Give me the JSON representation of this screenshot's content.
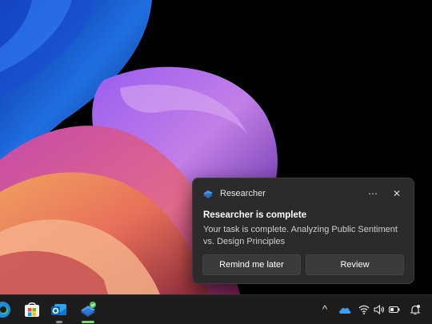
{
  "notification": {
    "app_name": "Researcher",
    "title": "Researcher is complete",
    "body": "Your task is complete. Analyzing Public Sentiment vs. Design Principles",
    "more_glyph": "⋯",
    "close_glyph": "✕",
    "actions": [
      {
        "label": "Remind me later"
      },
      {
        "label": "Review"
      }
    ]
  },
  "taskbar": {
    "pinned_icons": [
      "edge-icon",
      "store-icon",
      "outlook-icon",
      "researcher-copilot-icon"
    ],
    "tray_icons": [
      "chevron-up-icon",
      "onedrive-icon",
      "wifi-icon",
      "volume-icon",
      "battery-icon",
      "notification-bell-icon"
    ],
    "chevron_glyph": "^"
  },
  "colors": {
    "toast_bg": "#2b2b2b",
    "taskbar_bg": "#1c1c1c",
    "accent_blue": "#2f8de4",
    "indicator_green": "#7ad36f"
  }
}
